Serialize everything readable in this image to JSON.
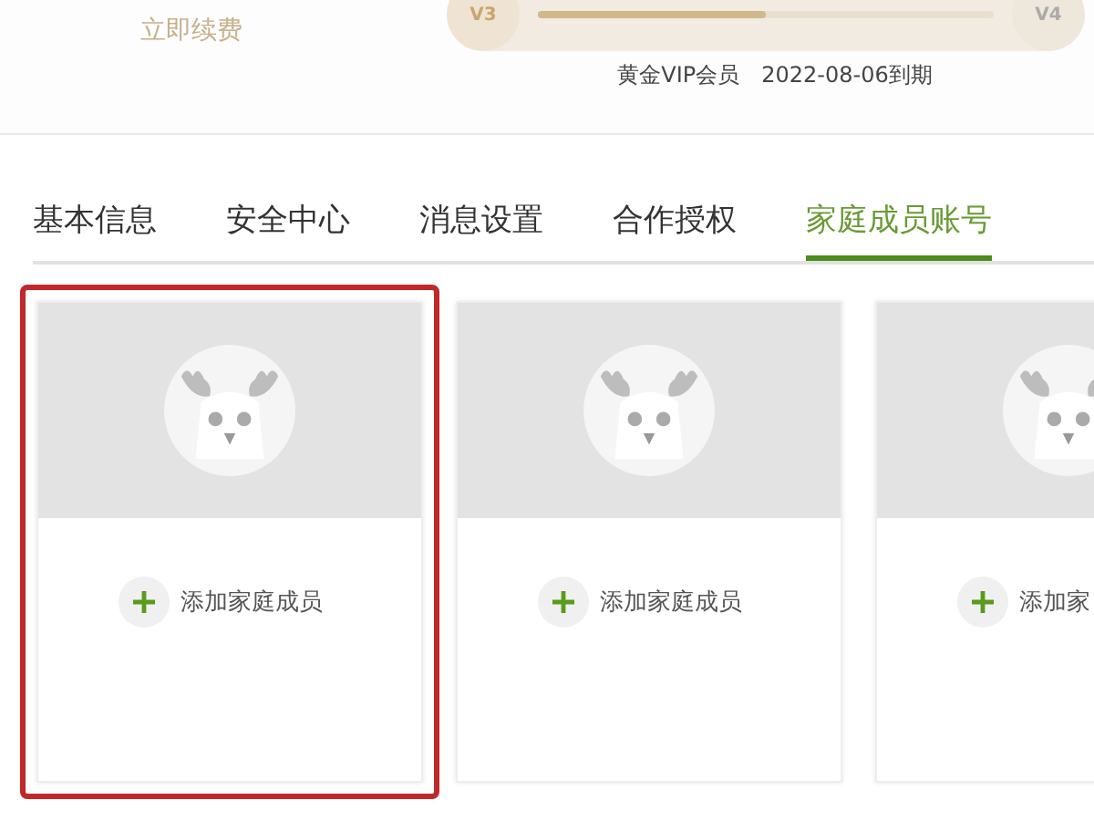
{
  "renew_link": "立即续费",
  "level_bar": {
    "current_badge": "V3",
    "next_badge": "V4",
    "level": 0.5
  },
  "membership": {
    "tier": "黄金VIP会员",
    "expiry": "2022-08-06到期"
  },
  "tabs": [
    {
      "label": "基本信息",
      "selected": false
    },
    {
      "label": "安全中心",
      "selected": false
    },
    {
      "label": "消息设置",
      "selected": false
    },
    {
      "label": "合作授权",
      "selected": false
    },
    {
      "label": "家庭成员账号",
      "selected": true
    }
  ],
  "member_cards": [
    {
      "label": "添加家庭成员",
      "highlighted": true
    },
    {
      "label": "添加家庭成员",
      "highlighted": false
    },
    {
      "label": "添加家",
      "highlighted": false
    }
  ]
}
